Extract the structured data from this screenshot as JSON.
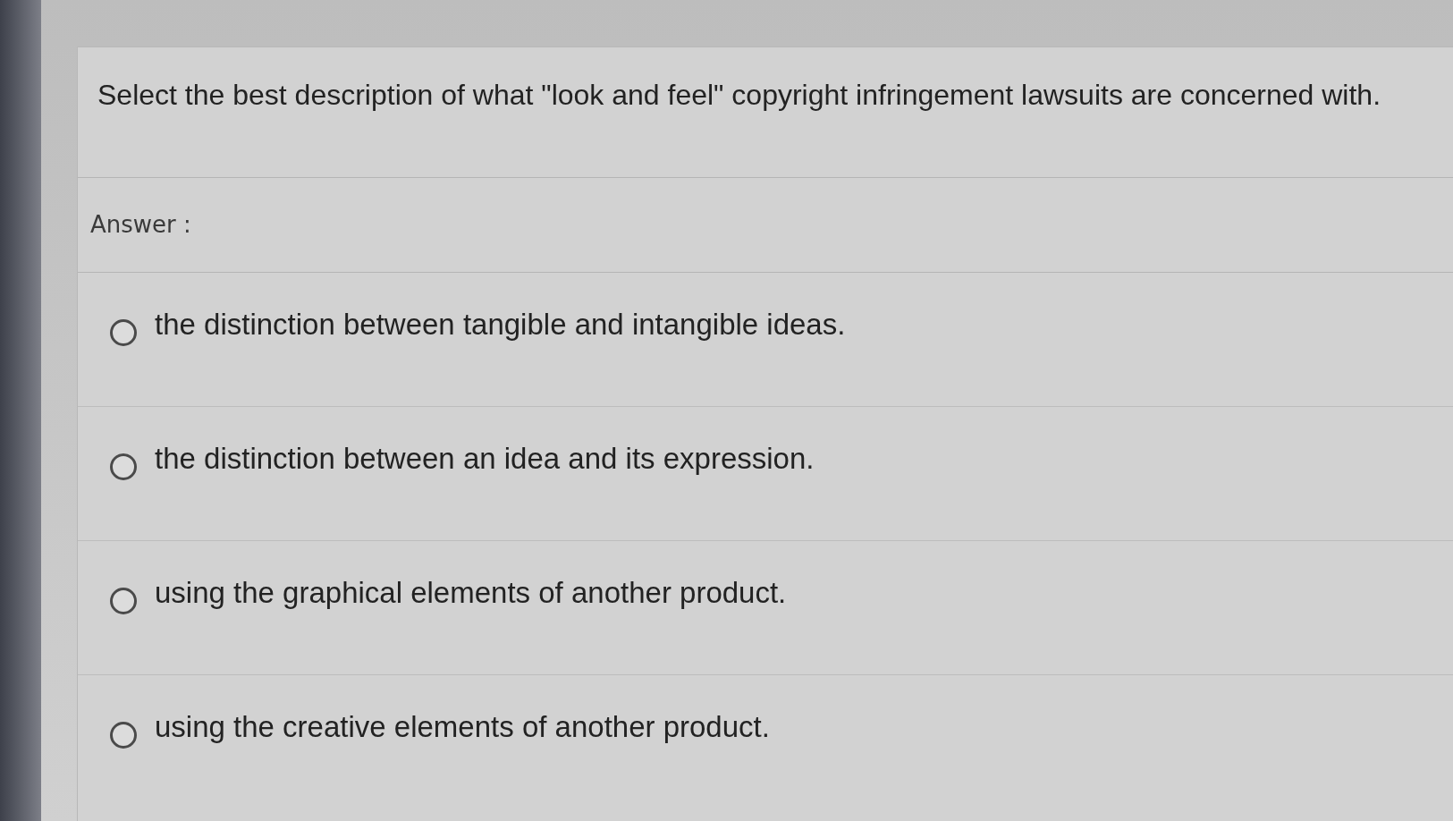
{
  "question": {
    "text": "Select the best description of what \"look and feel\" copyright infringement lawsuits are concerned with."
  },
  "answer_label": "Answer :",
  "options": [
    {
      "label": "the distinction between tangible and intangible ideas.",
      "selected": false
    },
    {
      "label": "the distinction between an idea and its expression.",
      "selected": false
    },
    {
      "label": "using the graphical elements of another product.",
      "selected": false
    },
    {
      "label": "using the creative elements of another product.",
      "selected": false
    }
  ]
}
